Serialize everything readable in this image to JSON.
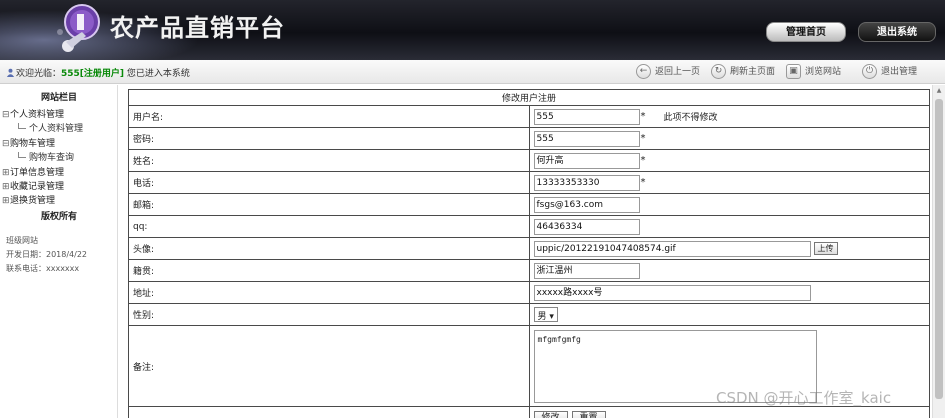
{
  "header": {
    "site_title": "农产品直销平台",
    "admin_home_label": "管理首页",
    "logout_label": "退出系统"
  },
  "toolbar": {
    "welcome_prefix": "欢迎光临：",
    "username": "555[注册用户]",
    "welcome_suffix": "您已进入本系统",
    "items": [
      {
        "label": "返回上一页",
        "icon": "back-icon"
      },
      {
        "label": "刷新主页面",
        "icon": "refresh-icon"
      },
      {
        "label": "浏览网站",
        "icon": "browse-icon"
      },
      {
        "label": "退出管理",
        "icon": "power-icon"
      }
    ]
  },
  "sidebar": {
    "title": "网站栏目",
    "groups": [
      {
        "label": "个人资料管理",
        "expander": "⊟",
        "children": [
          "个人资料管理"
        ]
      },
      {
        "label": "购物车管理",
        "expander": "⊟",
        "children": [
          "购物车查询"
        ]
      },
      {
        "label": "订单信息管理",
        "expander": "⊞",
        "children": []
      },
      {
        "label": "收藏记录管理",
        "expander": "⊞",
        "children": []
      },
      {
        "label": "退换货管理",
        "expander": "⊞",
        "children": []
      }
    ],
    "copyright_title": "版权所有",
    "info": {
      "org": "班级网站",
      "dev_date": "开发日期：2018/4/22",
      "phone": "联系电话：xxxxxxx"
    }
  },
  "form": {
    "caption": "修改用户注册",
    "fields": {
      "username": {
        "label": "用户名:",
        "value": "555",
        "required": "*",
        "note": "此项不得修改"
      },
      "password": {
        "label": "密码:",
        "value": "555",
        "required": "*"
      },
      "name": {
        "label": "姓名:",
        "value": "何升高",
        "required": "*"
      },
      "phone": {
        "label": "电话:",
        "value": "13333353330",
        "required": "*"
      },
      "email": {
        "label": "邮箱:",
        "value": "fsgs@163.com"
      },
      "qq": {
        "label": "qq:",
        "value": "46436334"
      },
      "avatar": {
        "label": "头像:",
        "value": "uppic/20122191047408574.gif",
        "upload_label": "上传"
      },
      "hometown": {
        "label": "籍贯:",
        "value": "浙江温州"
      },
      "address": {
        "label": "地址:",
        "value": "xxxxx路xxxx号"
      },
      "gender": {
        "label": "性别:",
        "value": "男"
      },
      "remark": {
        "label": "备注:",
        "value": "mfgmfgmfg"
      }
    },
    "submit_label": "修改",
    "reset_label": "重置"
  },
  "watermark": "CSDN @开心工作室_kaic"
}
